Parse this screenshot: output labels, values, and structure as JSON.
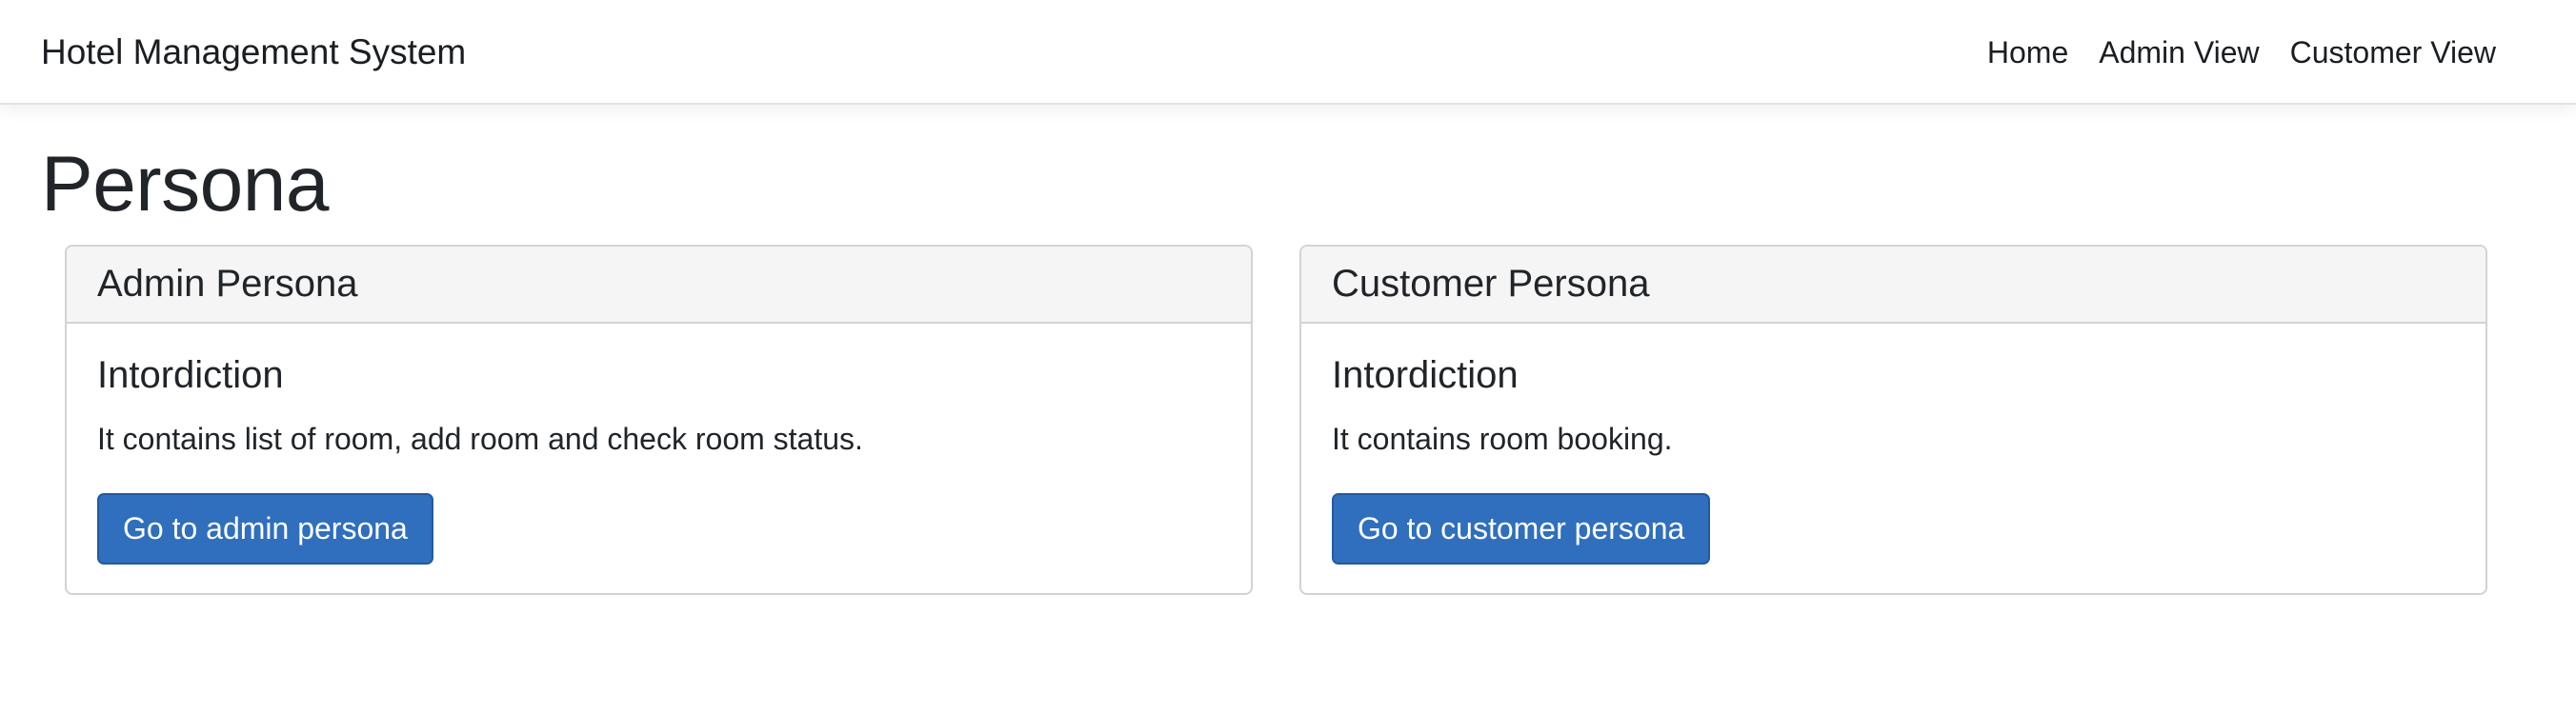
{
  "navbar": {
    "brand": "Hotel Management System",
    "links": [
      {
        "label": "Home"
      },
      {
        "label": "Admin View"
      },
      {
        "label": "Customer View"
      }
    ]
  },
  "page": {
    "title": "Persona"
  },
  "cards": [
    {
      "header": "Admin Persona",
      "intro_title": "Intordiction",
      "text": "It contains list of room, add room and check room status.",
      "button_label": "Go to admin persona"
    },
    {
      "header": "Customer Persona",
      "intro_title": "Intordiction",
      "text": "It contains room booking.",
      "button_label": "Go to customer persona"
    }
  ],
  "colors": {
    "primary_button": "#2f6fbd",
    "card_header_bg": "#f5f5f5",
    "text": "#212529"
  }
}
